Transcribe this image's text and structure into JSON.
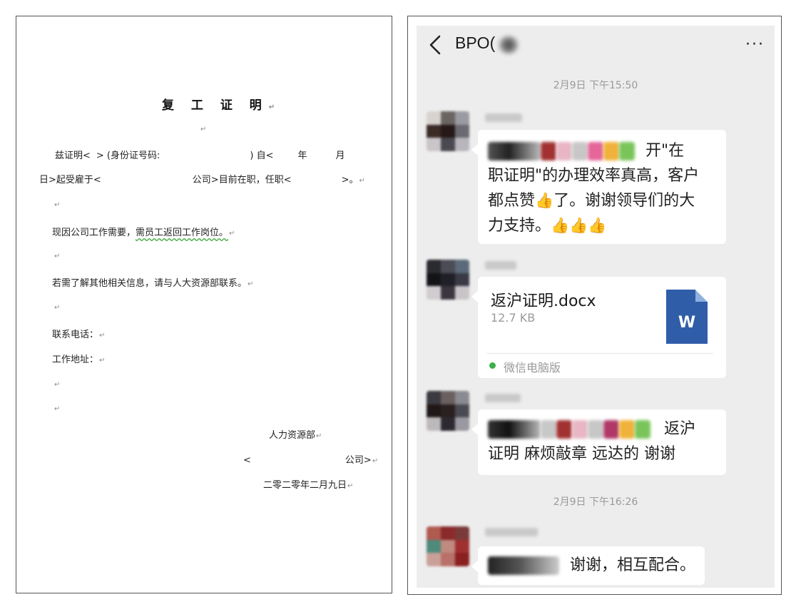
{
  "document": {
    "title": "复 工 证 明",
    "line1_a": "兹证明<",
    "line1_b": "> (身份证号码:",
    "line1_c": ") 自<",
    "line1_d": "年",
    "line1_e": "月",
    "line2_a": "日>起受雇于<",
    "line2_b": "公司>目前在职，任职<",
    "line2_c": ">。",
    "para2_a": "现因公司工作需要，",
    "para2_b": "需员工返回工作岗位。",
    "para3": "若需了解其他相关信息，请与人大资源部联系。",
    "contact": "联系电话：",
    "address": "工作地址：",
    "dept": "人力资源部",
    "company_a": "<",
    "company_b": "公司>",
    "date": "二零二零年二月九日",
    "mark": "↵"
  },
  "chat": {
    "title": "BPO(",
    "more": "···",
    "timestamp1": "2月9日 下午15:50",
    "msg1_lead": "开\"在",
    "msg1_l2": "职证明\"的办理效率真高，客户",
    "msg1_l3a": "都点赞",
    "msg1_emoji": "👍",
    "msg1_l3b": "了。谢谢领导们的大",
    "msg1_l4": "力支持。",
    "msg1_emojis": "👍👍👍",
    "file_name": "返沪证明.docx",
    "file_size": "12.7 KB",
    "file_icon_letter": "W",
    "file_source": "微信电脑版",
    "msg3_lead": "返沪",
    "msg3_l2": "证明 麻烦敲章 远达的 谢谢",
    "timestamp2": "2月9日 下午16:26",
    "msg4_text": "谢谢，相互配合。"
  },
  "colors": {
    "chat_bg": "#ededed",
    "word_blue": "#2f5da8",
    "wechat_green": "#3cb04a"
  }
}
